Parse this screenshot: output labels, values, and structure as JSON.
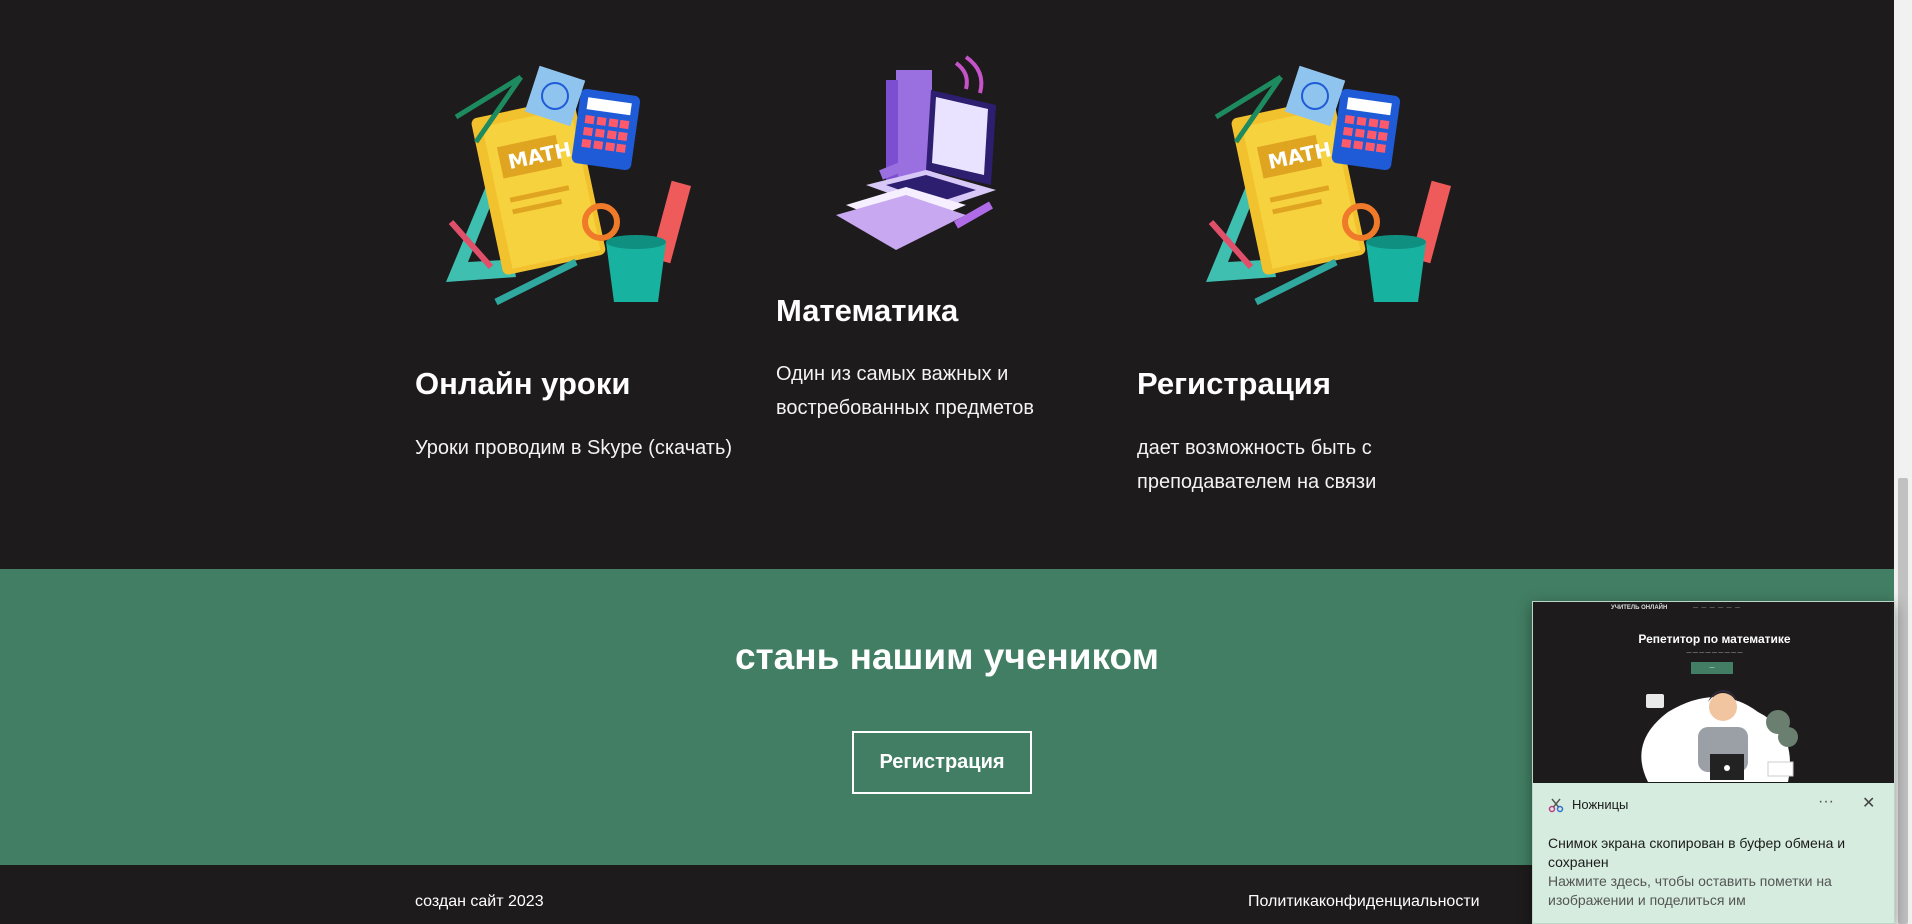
{
  "features": [
    {
      "title": "Онлайн уроки",
      "description": "Уроки проводим в Skype (скачать)",
      "illustration": "math-supplies-icon"
    },
    {
      "title": "Математика",
      "description": "Один из самых важных и востребованных предметов",
      "illustration": "laptop-books-icon"
    },
    {
      "title": "Регистрация",
      "description": "дает возможность быть с преподавателем на связи",
      "illustration": "math-supplies-icon"
    }
  ],
  "cta": {
    "title": "стань нашим учеником",
    "button_label": "Регистрация"
  },
  "footer": {
    "copyright": "создан сайт 2023",
    "privacy_link": "Политикаконфиденциальности"
  },
  "notification": {
    "app_name": "Ножницы",
    "message": "Снимок экрана скопирован в буфер обмена и сохранен",
    "hint": "Нажмите здесь, чтобы оставить пометки на изображении и поделиться им",
    "more_icon": "more-icon",
    "close_icon": "close-icon",
    "preview": {
      "brand": "УЧИТЕЛЬ ОНЛАЙН",
      "title": "Репетитор по математике"
    }
  },
  "colors": {
    "background": "#1d1b1b",
    "accent_green": "#427e63",
    "toast_bg": "#d5ecdf"
  }
}
